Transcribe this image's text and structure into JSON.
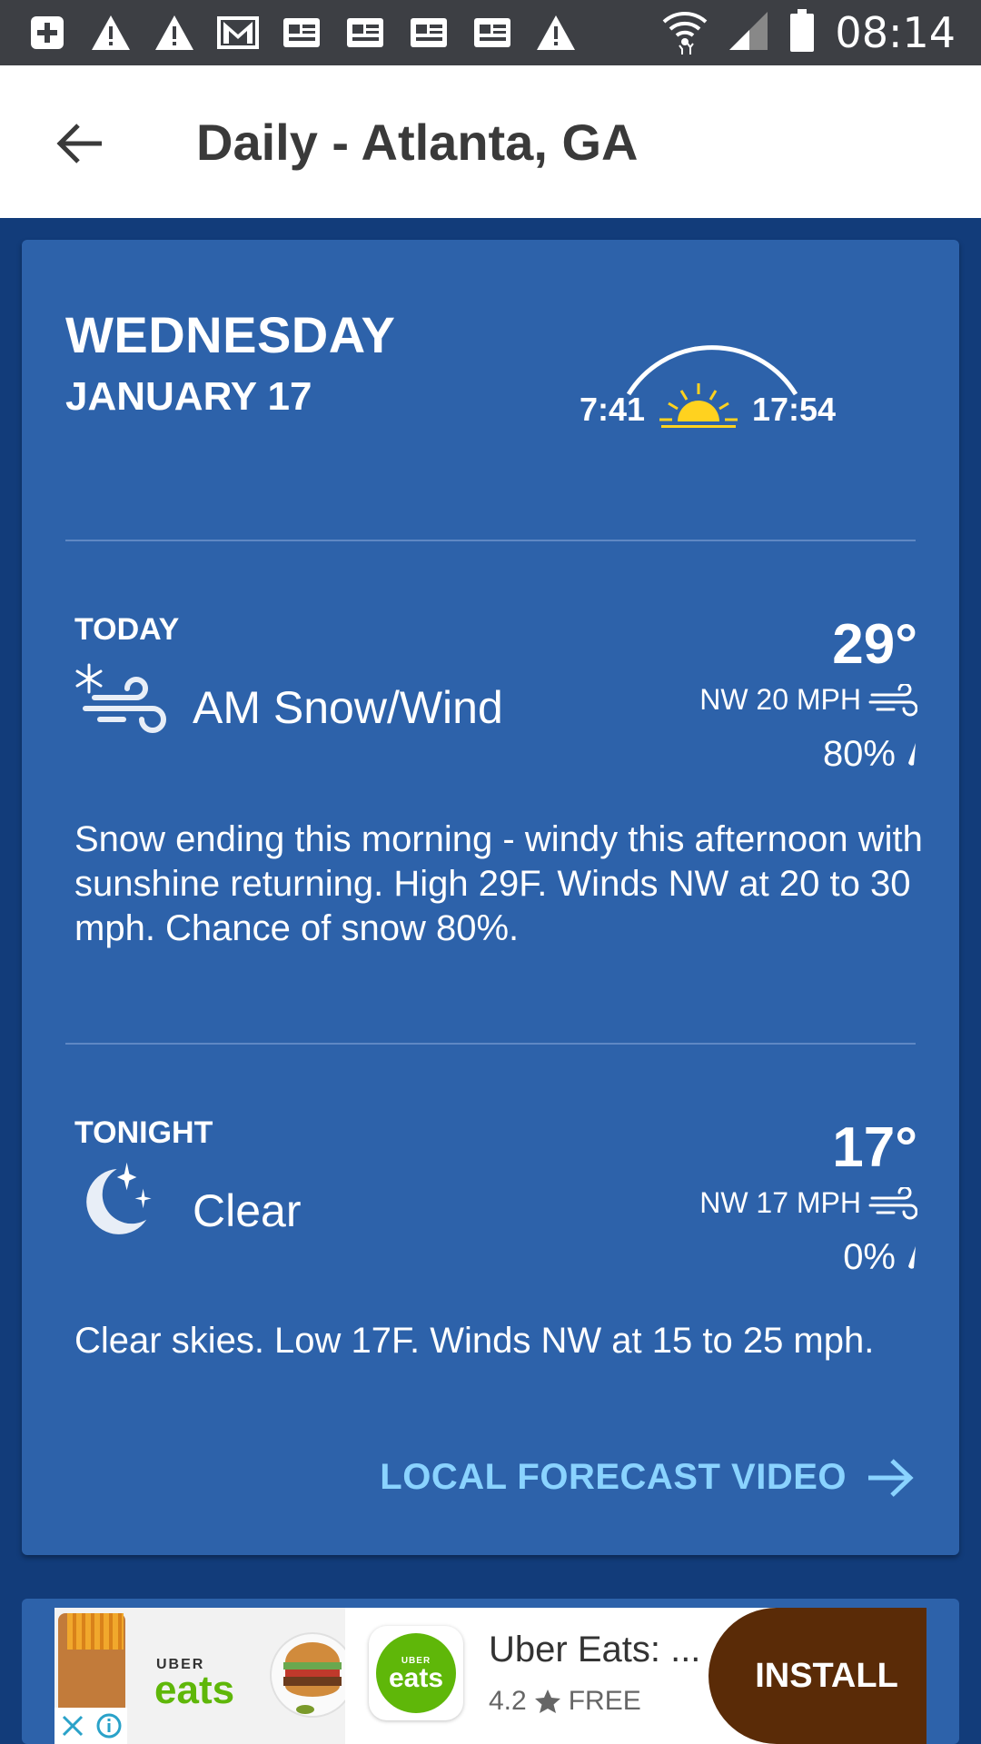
{
  "status_bar": {
    "time": "08:14",
    "notification_icons": [
      "add-box-icon",
      "warning-icon",
      "warning-icon",
      "gmail-icon",
      "news-icon",
      "news-icon",
      "news-icon",
      "news-icon",
      "warning-icon"
    ],
    "system_icons": [
      "wifi-icon",
      "cell-signal-icon",
      "battery-icon"
    ]
  },
  "app_bar": {
    "title": "Daily - Atlanta, GA",
    "back_icon": "arrow-back-icon"
  },
  "day": {
    "name": "WEDNESDAY",
    "date": "JANUARY 17",
    "sunrise": "7:41",
    "sunset": "17:54"
  },
  "today": {
    "label": "TODAY",
    "temp": "29°",
    "condition": "AM Snow/Wind",
    "condition_icon": "snow-wind-icon",
    "wind": "NW 20 MPH",
    "precip": "80%",
    "narrative": "Snow ending this morning - windy this afternoon with sunshine returning. High 29F. Winds NW at 20 to 30 mph. Chance of snow 80%."
  },
  "tonight": {
    "label": "TONIGHT",
    "temp": "17°",
    "condition": "Clear",
    "condition_icon": "moon-stars-icon",
    "wind": "NW 17 MPH",
    "precip": "0%",
    "narrative": "Clear skies. Low 17F. Winds NW at 15 to 25 mph."
  },
  "video_link": {
    "label": "LOCAL FORECAST VIDEO"
  },
  "ad": {
    "wordmark_top": "UBER",
    "wordmark": "eats",
    "logo_top": "UBER",
    "logo_text": "eats",
    "app_name": "Uber Eats: ...",
    "rating": "4.2",
    "price": "FREE",
    "install_label": "INSTALL"
  },
  "colors": {
    "status_bar": "#3d3f44",
    "background": "#123c7a",
    "card": "#2d62aa",
    "link": "#8ad3ff",
    "sun": "#ffd21f",
    "install_button": "#5a2b07",
    "uber_green": "#5fb709"
  }
}
